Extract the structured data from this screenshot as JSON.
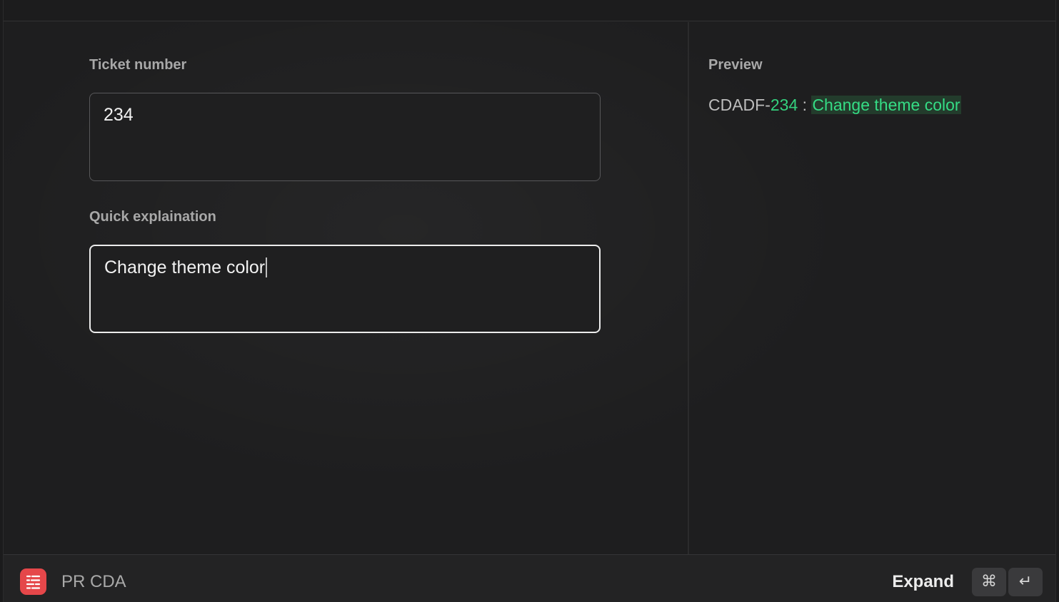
{
  "form": {
    "ticket_label": "Ticket number",
    "ticket_value": "234",
    "explanation_label": "Quick explaination",
    "explanation_value": "Change theme color"
  },
  "preview": {
    "label": "Preview",
    "prefix": "CDADF-",
    "number": "234",
    "separator": " : ",
    "explanation": "Change theme color",
    "number_color": "#34d17e",
    "highlight_color": "#35dc85"
  },
  "footer": {
    "app_icon": "list-icon",
    "app_name": "PR CDA",
    "action_label": "Expand",
    "shortcut_cmd": "⌘",
    "shortcut_return": "↵",
    "app_icon_color": "#e5474a"
  }
}
